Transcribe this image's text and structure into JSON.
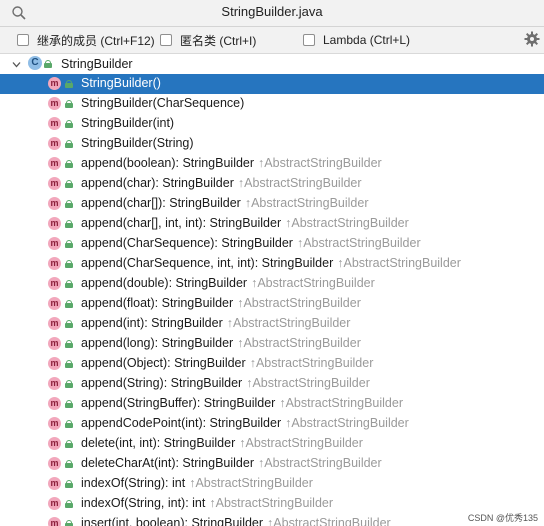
{
  "header": {
    "title": "StringBuilder.java",
    "search_value": ""
  },
  "filters": [
    {
      "label": "继承的成员 (Ctrl+F12)",
      "checked": false
    },
    {
      "label": "匿名类 (Ctrl+I)",
      "checked": false
    },
    {
      "label": "Lambda (Ctrl+L)",
      "checked": false
    }
  ],
  "tree": {
    "root_label": "StringBuilder",
    "root_icon": "class-icon",
    "selected_index": 0,
    "items": [
      {
        "sig": "StringBuilder()",
        "inherit": ""
      },
      {
        "sig": "StringBuilder(CharSequence)",
        "inherit": ""
      },
      {
        "sig": "StringBuilder(int)",
        "inherit": ""
      },
      {
        "sig": "StringBuilder(String)",
        "inherit": ""
      },
      {
        "sig": "append(boolean): StringBuilder",
        "inherit": "↑AbstractStringBuilder"
      },
      {
        "sig": "append(char): StringBuilder",
        "inherit": "↑AbstractStringBuilder"
      },
      {
        "sig": "append(char[]): StringBuilder",
        "inherit": "↑AbstractStringBuilder"
      },
      {
        "sig": "append(char[], int, int): StringBuilder",
        "inherit": "↑AbstractStringBuilder"
      },
      {
        "sig": "append(CharSequence): StringBuilder",
        "inherit": "↑AbstractStringBuilder"
      },
      {
        "sig": "append(CharSequence, int, int): StringBuilder",
        "inherit": "↑AbstractStringBuilder"
      },
      {
        "sig": "append(double): StringBuilder",
        "inherit": "↑AbstractStringBuilder"
      },
      {
        "sig": "append(float): StringBuilder",
        "inherit": "↑AbstractStringBuilder"
      },
      {
        "sig": "append(int): StringBuilder",
        "inherit": "↑AbstractStringBuilder"
      },
      {
        "sig": "append(long): StringBuilder",
        "inherit": "↑AbstractStringBuilder"
      },
      {
        "sig": "append(Object): StringBuilder",
        "inherit": "↑AbstractStringBuilder"
      },
      {
        "sig": "append(String): StringBuilder",
        "inherit": "↑AbstractStringBuilder"
      },
      {
        "sig": "append(StringBuffer): StringBuilder",
        "inherit": "↑AbstractStringBuilder"
      },
      {
        "sig": "appendCodePoint(int): StringBuilder",
        "inherit": "↑AbstractStringBuilder"
      },
      {
        "sig": "delete(int, int): StringBuilder",
        "inherit": "↑AbstractStringBuilder"
      },
      {
        "sig": "deleteCharAt(int): StringBuilder",
        "inherit": "↑AbstractStringBuilder"
      },
      {
        "sig": "indexOf(String): int",
        "inherit": "↑AbstractStringBuilder"
      },
      {
        "sig": "indexOf(String, int): int",
        "inherit": "↑AbstractStringBuilder"
      },
      {
        "sig": "insert(int, boolean): StringBuilder",
        "inherit": "↑AbstractStringBuilder"
      }
    ]
  },
  "watermark": "CSDN @优秀135",
  "colors": {
    "selection": "#2675bf",
    "method_icon": "#f2a7bc",
    "class_icon": "#8fbde6",
    "lock": "#59a869",
    "inherit_text": "#9a9a9a"
  }
}
